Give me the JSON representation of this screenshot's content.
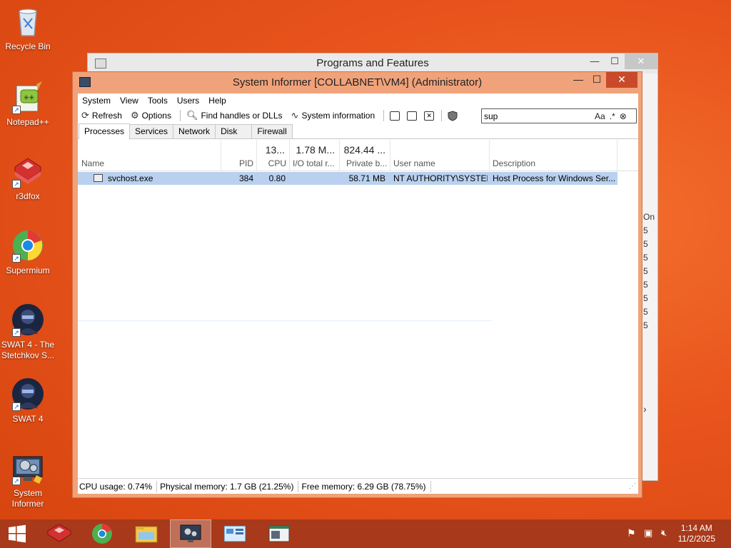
{
  "desktop": {
    "icons": [
      {
        "label": "Recycle Bin"
      },
      {
        "label": "Notepad++"
      },
      {
        "label": "r3dfox"
      },
      {
        "label": "Supermium"
      },
      {
        "label": "SWAT 4 - The Stetchkov S..."
      },
      {
        "label": "SWAT 4"
      },
      {
        "label": "System Informer"
      }
    ]
  },
  "programs_window": {
    "title": "Programs and Features",
    "side_header": "On",
    "side_values": [
      "5",
      "5",
      "5",
      "5",
      "5",
      "5",
      "5",
      "5"
    ],
    "scroll_arrow": "›"
  },
  "si_window": {
    "title": "System Informer [COLLABNET\\VM4] (Administrator)",
    "menu": [
      "System",
      "View",
      "Tools",
      "Users",
      "Help"
    ],
    "toolbar": {
      "refresh": "Refresh",
      "options": "Options",
      "find_handles": "Find handles or DLLs",
      "system_information": "System information"
    },
    "search": {
      "value": "sup",
      "match_case": "Aa",
      "regex": ".*"
    },
    "tabs": [
      "Processes",
      "Services",
      "Network",
      "Disk",
      "Firewall"
    ],
    "columns": {
      "name": "Name",
      "pid": "PID",
      "cpu": "CPU",
      "cpu_total": "13...",
      "io": "I/O total r...",
      "io_total": "1.78 M...",
      "private": "Private b...",
      "private_total": "824.44 ...",
      "user": "User name",
      "description": "Description"
    },
    "rows": [
      {
        "name": "svchost.exe",
        "pid": "384",
        "cpu": "0.80",
        "io": "",
        "private": "58.71 MB",
        "user": "NT AUTHORITY\\SYSTEM",
        "description": "Host Process for Windows Ser..."
      }
    ],
    "status": {
      "cpu": "CPU usage: 0.74%",
      "physical": "Physical memory: 1.7 GB (21.25%)",
      "free": "Free memory: 6.29 GB (78.75%)"
    }
  },
  "taskbar": {
    "time": "1:14 AM",
    "date": "11/2/2025"
  },
  "colors": {
    "desktop": "#e8541c",
    "taskbar": "#a8391a",
    "selection": "#b9d1ee",
    "window_frame": "#f0a27a",
    "close_button": "#c84a2a"
  }
}
